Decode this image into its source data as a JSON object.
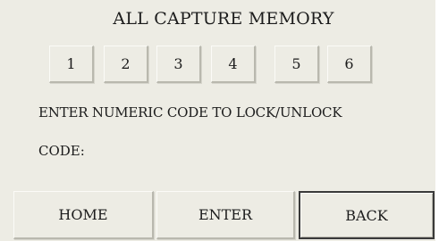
{
  "title": "ALL CAPTURE MEMORY",
  "keys": [
    "1",
    "2",
    "3",
    "4",
    "5",
    "6"
  ],
  "instruction": "ENTER NUMERIC CODE TO LOCK/UNLOCK",
  "code": {
    "label": "CODE:",
    "value": ""
  },
  "buttons": {
    "home": "HOME",
    "enter": "ENTER",
    "back": "BACK"
  },
  "colors": {
    "background": "#edece4",
    "text": "#1c1c1c",
    "focused_border": "#3a3a3a"
  }
}
